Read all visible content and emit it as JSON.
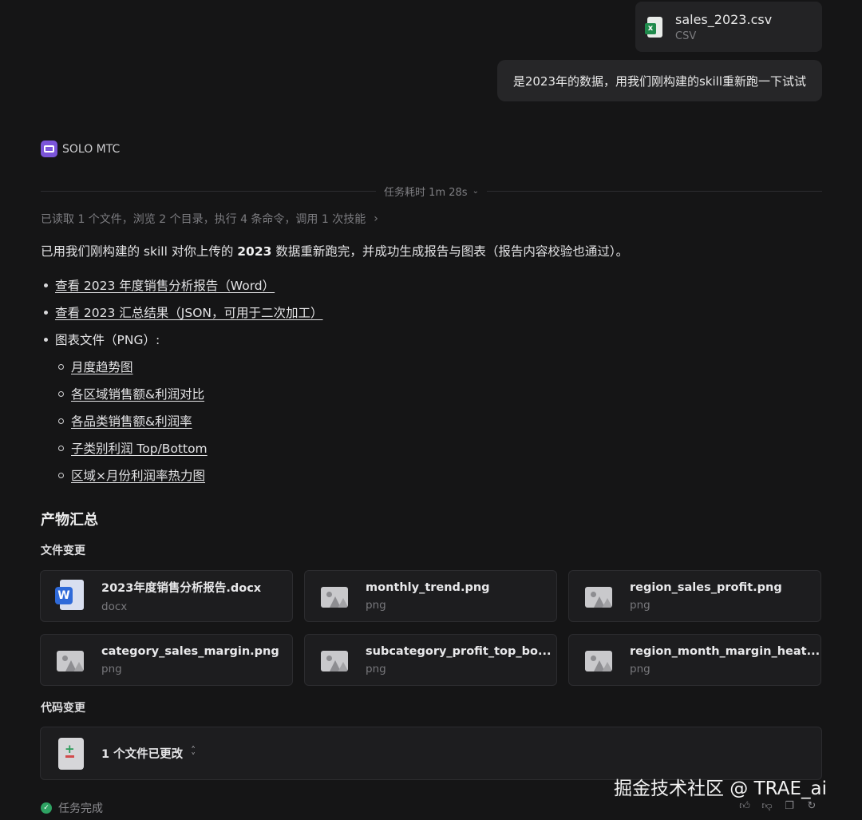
{
  "attachment": {
    "name": "sales_2023.csv",
    "type": "CSV"
  },
  "user_message": "是2023年的数据，用我们刚构建的skill重新跑一下试试",
  "agent": {
    "name": "SOLO MTC"
  },
  "task_time": "任务耗时 1m 28s",
  "stats": "已读取 1 个文件，浏览 2 个目录，执行 4 条命令，调用 1 次技能",
  "summary": {
    "prefix": "已用我们刚构建的 skill 对你上传的 ",
    "bold": "2023",
    "suffix": " 数据重新跑完，并成功生成报告与图表（报告内容校验也通过）。"
  },
  "links": {
    "report": "查看 2023 年度销售分析报告（Word）",
    "json": "查看 2023 汇总结果（JSON，可用于二次加工）",
    "charts_label": "图表文件（PNG）:",
    "charts": [
      "月度趋势图",
      "各区域销售额&利润对比",
      "各品类销售额&利润率",
      "子类别利润 Top/Bottom",
      "区域×月份利润率热力图"
    ]
  },
  "outputs": {
    "title": "产物汇总",
    "files_title": "文件变更",
    "files": [
      {
        "name": "2023年度销售分析报告.docx",
        "type": "docx",
        "icon": "word-icon"
      },
      {
        "name": "monthly_trend.png",
        "type": "png",
        "icon": "image-icon"
      },
      {
        "name": "region_sales_profit.png",
        "type": "png",
        "icon": "image-icon"
      },
      {
        "name": "category_sales_margin.png",
        "type": "png",
        "icon": "image-icon"
      },
      {
        "name": "subcategory_profit_top_bo...",
        "type": "png",
        "icon": "image-icon"
      },
      {
        "name": "region_month_margin_heat...",
        "type": "png",
        "icon": "image-icon"
      }
    ],
    "code_title": "代码变更",
    "code_change": "1 个文件已更改"
  },
  "status": "任务完成",
  "watermark": "掘金技术社区 @ TRAE_ai"
}
